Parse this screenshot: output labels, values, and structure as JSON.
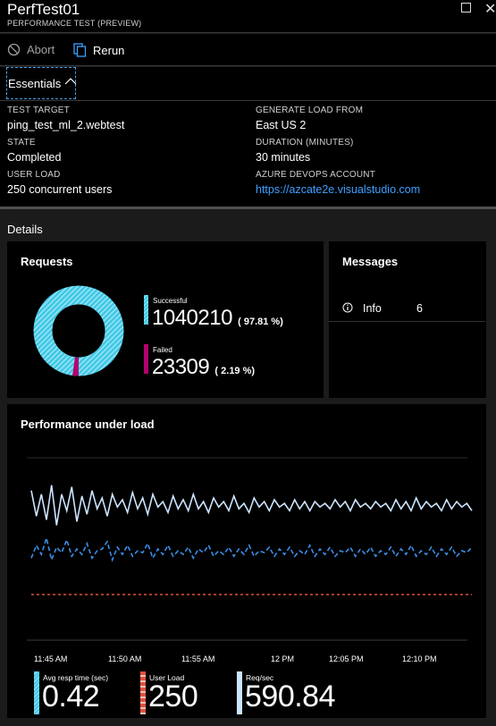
{
  "window": {
    "title": "PerfTest01",
    "subtitle": "PERFORMANCE TEST (PREVIEW)",
    "maximize_icon": "maximize-icon",
    "close_label": "✕"
  },
  "toolbar": {
    "abort_label": "Abort",
    "rerun_label": "Rerun"
  },
  "essentials": {
    "toggle_label": "Essentials",
    "test_target_label": "TEST TARGET",
    "test_target_value": "ping_test_ml_2.webtest",
    "state_label": "STATE",
    "state_value": "Completed",
    "user_load_label": "USER LOAD",
    "user_load_value": "250 concurrent users",
    "generate_load_label": "GENERATE LOAD FROM",
    "generate_load_value": "East US 2",
    "duration_label": "DURATION (MINUTES)",
    "duration_value": "30 minutes",
    "devops_label": "AZURE DEVOPS ACCOUNT",
    "devops_value": "https://azcate2e.visualstudio.com"
  },
  "details": {
    "title": "Details"
  },
  "requests": {
    "title": "Requests",
    "successful_label": "Successful",
    "successful_value": "1040210",
    "successful_pct": "( 97.81 %)",
    "failed_label": "Failed",
    "failed_value": "23309",
    "failed_pct": "( 2.19 %)",
    "colors": {
      "successful": "#3fc8e6",
      "failed": "#b4006f"
    }
  },
  "messages": {
    "title": "Messages",
    "info_label": "Info",
    "info_count": "6"
  },
  "performance": {
    "title": "Performance under load",
    "metrics": {
      "avg_resp_label": "Avg resp time (sec)",
      "avg_resp_value": "0.42",
      "user_load_label": "User Load",
      "user_load_value": "250",
      "req_sec_label": "Req/sec",
      "req_sec_value": "590.84"
    },
    "colors": {
      "req_sec": "#cce4ff",
      "avg_resp": "#3a8ee6",
      "user_load": "#e0503c"
    }
  },
  "chart_data": {
    "type": "line",
    "title": "Performance under load",
    "x_ticks": [
      "11:45 AM",
      "11:50 AM",
      "11:55 AM",
      "12 PM",
      "12:05 PM",
      "12:10 PM"
    ],
    "y_axis": "unlabeled",
    "grid": true,
    "legend_placement": "bottom",
    "series": [
      {
        "name": "Req/sec",
        "values": [
          0.82,
          0.68,
          0.8,
          0.66,
          0.85,
          0.63,
          0.8,
          0.71,
          0.84,
          0.65,
          0.79,
          0.69,
          0.82,
          0.72,
          0.78,
          0.68,
          0.8,
          0.73,
          0.77,
          0.7,
          0.81,
          0.72,
          0.78,
          0.69,
          0.8,
          0.73,
          0.76,
          0.7,
          0.79,
          0.72,
          0.77,
          0.71,
          0.8,
          0.72,
          0.76,
          0.7,
          0.78,
          0.73,
          0.76,
          0.71,
          0.79,
          0.72,
          0.75,
          0.7,
          0.78,
          0.73,
          0.76,
          0.71,
          0.77,
          0.73,
          0.75,
          0.71,
          0.77,
          0.72,
          0.76,
          0.71,
          0.76,
          0.73,
          0.75,
          0.72,
          0.77,
          0.73,
          0.76,
          0.71,
          0.77,
          0.73,
          0.75,
          0.72,
          0.76,
          0.73,
          0.75,
          0.71,
          0.77,
          0.72,
          0.76,
          0.71,
          0.78,
          0.72,
          0.76,
          0.73,
          0.75,
          0.71,
          0.77,
          0.72,
          0.76,
          0.73,
          0.75,
          0.71
        ]
      },
      {
        "name": "Avg resp time (sec)",
        "values": [
          0.45,
          0.52,
          0.47,
          0.56,
          0.44,
          0.51,
          0.48,
          0.55,
          0.46,
          0.5,
          0.47,
          0.53,
          0.45,
          0.49,
          0.5,
          0.54,
          0.44,
          0.51,
          0.47,
          0.52,
          0.46,
          0.49,
          0.48,
          0.53,
          0.45,
          0.5,
          0.47,
          0.52,
          0.46,
          0.49,
          0.47,
          0.51,
          0.45,
          0.5,
          0.48,
          0.52,
          0.46,
          0.49,
          0.47,
          0.51,
          0.46,
          0.5,
          0.47,
          0.52,
          0.46,
          0.49,
          0.48,
          0.51,
          0.46,
          0.5,
          0.47,
          0.51,
          0.46,
          0.49,
          0.47,
          0.52,
          0.46,
          0.5,
          0.47,
          0.51,
          0.46,
          0.49,
          0.48,
          0.51,
          0.46,
          0.5,
          0.47,
          0.51,
          0.46,
          0.49,
          0.47,
          0.51,
          0.46,
          0.5,
          0.47,
          0.52,
          0.46,
          0.49,
          0.47,
          0.51,
          0.46,
          0.5,
          0.47,
          0.51,
          0.46,
          0.49,
          0.48,
          0.51
        ]
      },
      {
        "name": "User Load",
        "values": [
          0.25,
          0.25,
          0.25,
          0.25,
          0.25,
          0.25,
          0.25,
          0.25,
          0.25,
          0.25,
          0.25,
          0.25,
          0.25,
          0.25,
          0.25,
          0.25,
          0.25,
          0.25,
          0.25,
          0.25,
          0.25,
          0.25,
          0.25,
          0.25,
          0.25,
          0.25,
          0.25,
          0.25,
          0.25,
          0.25,
          0.25,
          0.25,
          0.25,
          0.25,
          0.25,
          0.25,
          0.25,
          0.25,
          0.25,
          0.25,
          0.25,
          0.25,
          0.25,
          0.25,
          0.25,
          0.25,
          0.25,
          0.25,
          0.25,
          0.25,
          0.25,
          0.25,
          0.25,
          0.25,
          0.25,
          0.25,
          0.25,
          0.25,
          0.25,
          0.25,
          0.25,
          0.25,
          0.25,
          0.25,
          0.25,
          0.25,
          0.25,
          0.25,
          0.25,
          0.25,
          0.25,
          0.25,
          0.25,
          0.25,
          0.25,
          0.25,
          0.25,
          0.25,
          0.25,
          0.25,
          0.25,
          0.25,
          0.25,
          0.25,
          0.25,
          0.25,
          0.25,
          0.25
        ]
      }
    ]
  }
}
